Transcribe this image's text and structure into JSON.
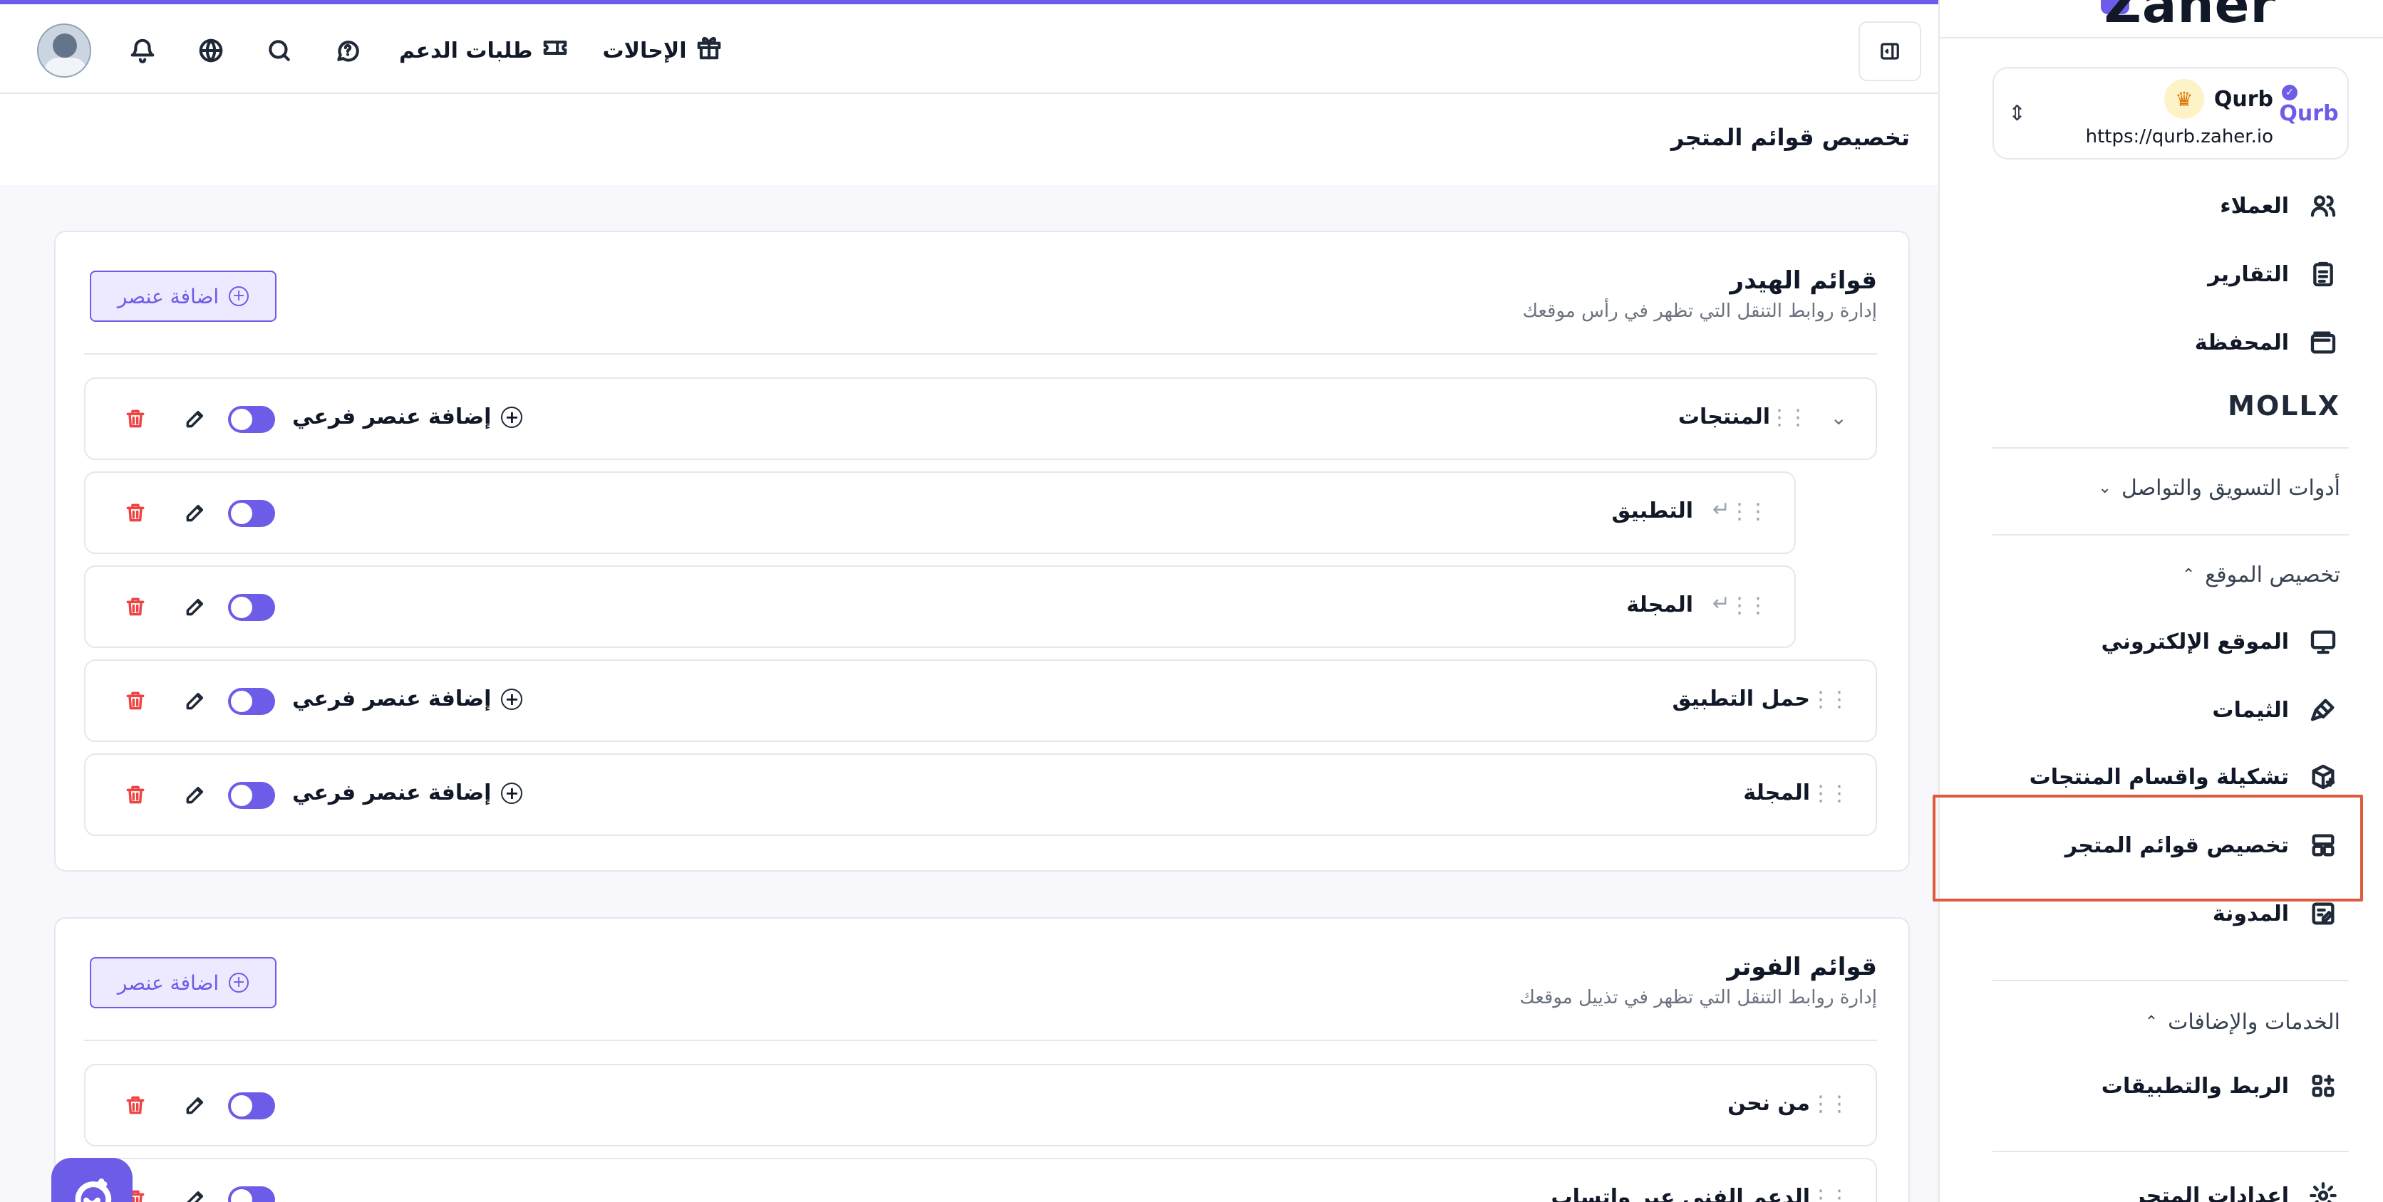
{
  "brand": {
    "name": "Zaher",
    "accent": "#6c5ce7"
  },
  "store": {
    "name": "Qurb",
    "url": "https://qurb.zaher.io",
    "logo_text": "Qurb"
  },
  "header": {
    "referrals_label": "الإحالات",
    "support_label": "طلبات الدعم",
    "icons": [
      "gift-icon",
      "ticket-icon",
      "chat-help-icon",
      "search-icon",
      "globe-icon",
      "bell-icon",
      "avatar"
    ]
  },
  "breadcrumb": "تخصيص قوائم المتجر",
  "sidebar": {
    "items_top": [
      {
        "label": "العملاء",
        "icon": "users-icon"
      },
      {
        "label": "التقارير",
        "icon": "clipboard-icon"
      },
      {
        "label": "المحفظة",
        "icon": "wallet-icon"
      }
    ],
    "mollix_label": "MOLLX",
    "marketing_section": "أدوات التسويق والتواصل",
    "site_section": "تخصيص الموقع",
    "site_items": [
      {
        "label": "الموقع الإلكتروني",
        "icon": "monitor-icon"
      },
      {
        "label": "الثيمات",
        "icon": "brush-icon"
      },
      {
        "label": "تشكيلة واقسام المنتجات",
        "icon": "box-icon"
      },
      {
        "label": "تخصيص قوائم المتجر",
        "icon": "layout-icon"
      },
      {
        "label": "المدونة",
        "icon": "note-icon"
      }
    ],
    "services_section": "الخدمات والإضافات",
    "services_items": [
      {
        "label": "الربط والتطبيقات",
        "icon": "apps-icon"
      },
      {
        "label": "اعدادات المتجر",
        "icon": "settings-icon"
      }
    ]
  },
  "header_menu": {
    "title": "قوائم الهيدر",
    "subtitle": "إدارة روابط التنقل التي تظهر في رأس موقعك",
    "add_label": "اضافة عنصر",
    "sub_add_label": "إضافة عنصر فرعي",
    "items": [
      {
        "label": "المنتجات",
        "type": "parent"
      },
      {
        "label": "التطبيق",
        "type": "child"
      },
      {
        "label": "المجلة",
        "type": "child"
      },
      {
        "label": "حمل التطبيق",
        "type": "parent"
      },
      {
        "label": "المجلة",
        "type": "parent"
      }
    ]
  },
  "footer_menu": {
    "title": "قوائم الفوتر",
    "subtitle": "إدارة روابط التنقل التي تظهر في تذييل موقعك",
    "add_label": "اضافة عنصر",
    "items": [
      {
        "label": "من نحن"
      },
      {
        "label": "الدعم الفني عبر واتساب"
      }
    ]
  }
}
